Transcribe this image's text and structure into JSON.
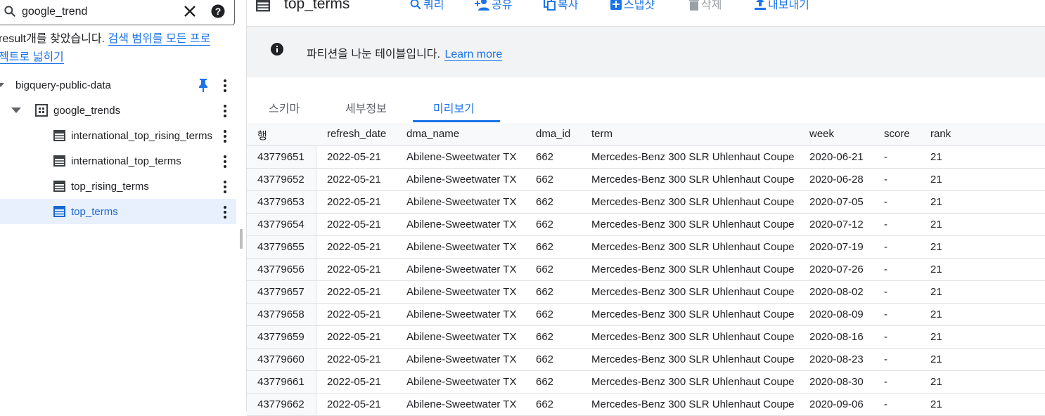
{
  "search": {
    "value": "google_trend",
    "clear_label": "✕",
    "help_label": "?"
  },
  "results": {
    "prefix": " result개를 찾았습니다. ",
    "link_line1": "검색 범위를 모든 프로",
    "link_line2": "젝트로 넓히기"
  },
  "tree": {
    "project": "bigquery-public-data",
    "dataset": "google_trends",
    "tables": [
      "international_top_rising_terms",
      "international_top_terms",
      "top_rising_terms",
      "top_terms"
    ]
  },
  "toolbar": {
    "title": "top_terms",
    "query": "쿼리",
    "share": "공유",
    "copy": "복사",
    "snapshot": "스냅샷",
    "delete": "삭제",
    "export": "내보내기"
  },
  "banner": {
    "text": "파티션을 나눈 테이블입니다.",
    "link": "Learn more"
  },
  "tabs": {
    "schema": "스키마",
    "details": "세부정보",
    "preview": "미리보기"
  },
  "table": {
    "columns": [
      "행",
      "refresh_date",
      "dma_name",
      "dma_id",
      "term",
      "week",
      "score",
      "rank"
    ],
    "rows": [
      [
        "43779651",
        "2022-05-21",
        "Abilene-Sweetwater TX",
        "662",
        "Mercedes-Benz 300 SLR Uhlenhaut Coupe",
        "2020-06-21",
        "-",
        "21"
      ],
      [
        "43779652",
        "2022-05-21",
        "Abilene-Sweetwater TX",
        "662",
        "Mercedes-Benz 300 SLR Uhlenhaut Coupe",
        "2020-06-28",
        "-",
        "21"
      ],
      [
        "43779653",
        "2022-05-21",
        "Abilene-Sweetwater TX",
        "662",
        "Mercedes-Benz 300 SLR Uhlenhaut Coupe",
        "2020-07-05",
        "-",
        "21"
      ],
      [
        "43779654",
        "2022-05-21",
        "Abilene-Sweetwater TX",
        "662",
        "Mercedes-Benz 300 SLR Uhlenhaut Coupe",
        "2020-07-12",
        "-",
        "21"
      ],
      [
        "43779655",
        "2022-05-21",
        "Abilene-Sweetwater TX",
        "662",
        "Mercedes-Benz 300 SLR Uhlenhaut Coupe",
        "2020-07-19",
        "-",
        "21"
      ],
      [
        "43779656",
        "2022-05-21",
        "Abilene-Sweetwater TX",
        "662",
        "Mercedes-Benz 300 SLR Uhlenhaut Coupe",
        "2020-07-26",
        "-",
        "21"
      ],
      [
        "43779657",
        "2022-05-21",
        "Abilene-Sweetwater TX",
        "662",
        "Mercedes-Benz 300 SLR Uhlenhaut Coupe",
        "2020-08-02",
        "-",
        "21"
      ],
      [
        "43779658",
        "2022-05-21",
        "Abilene-Sweetwater TX",
        "662",
        "Mercedes-Benz 300 SLR Uhlenhaut Coupe",
        "2020-08-09",
        "-",
        "21"
      ],
      [
        "43779659",
        "2022-05-21",
        "Abilene-Sweetwater TX",
        "662",
        "Mercedes-Benz 300 SLR Uhlenhaut Coupe",
        "2020-08-16",
        "-",
        "21"
      ],
      [
        "43779660",
        "2022-05-21",
        "Abilene-Sweetwater TX",
        "662",
        "Mercedes-Benz 300 SLR Uhlenhaut Coupe",
        "2020-08-23",
        "-",
        "21"
      ],
      [
        "43779661",
        "2022-05-21",
        "Abilene-Sweetwater TX",
        "662",
        "Mercedes-Benz 300 SLR Uhlenhaut Coupe",
        "2020-08-30",
        "-",
        "21"
      ],
      [
        "43779662",
        "2022-05-21",
        "Abilene-Sweetwater TX",
        "662",
        "Mercedes-Benz 300 SLR Uhlenhaut Coupe",
        "2020-09-06",
        "-",
        "21"
      ]
    ]
  },
  "colors": {
    "accent": "#1a73e8",
    "selected_bg": "#e8f0fe",
    "banner_bg": "#f1f3f4"
  }
}
